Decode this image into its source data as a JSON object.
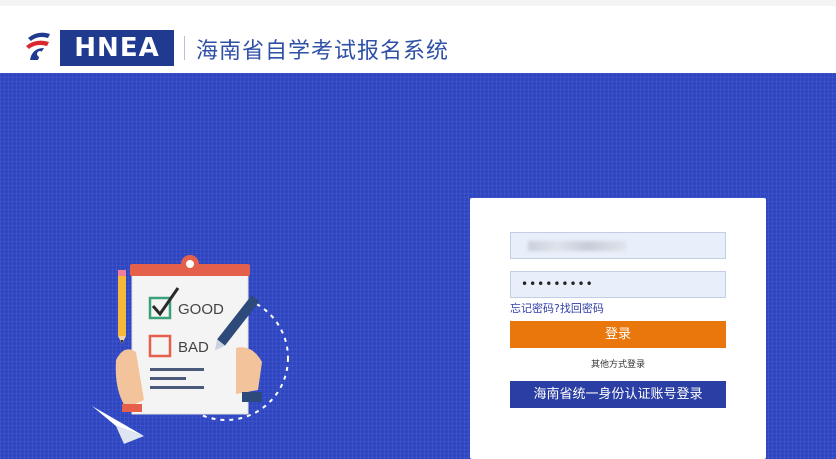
{
  "header": {
    "logo_text": "HNEA",
    "title": "海南省自学考试报名系统"
  },
  "login": {
    "username_value": "",
    "password_value": "•••••••••",
    "forgot_text": "忘记密码?找回密码",
    "login_label": "登录",
    "other_methods_text": "其他方式登录",
    "unified_login_label": "海南省统一身份认证账号登录"
  },
  "illustration": {
    "good_label": "GOOD",
    "bad_label": "BAD"
  },
  "colors": {
    "brand_blue": "#1f3a8f",
    "banner_blue": "#2f46c2",
    "login_orange": "#e9770b",
    "unified_blue": "#2b3ea3"
  }
}
